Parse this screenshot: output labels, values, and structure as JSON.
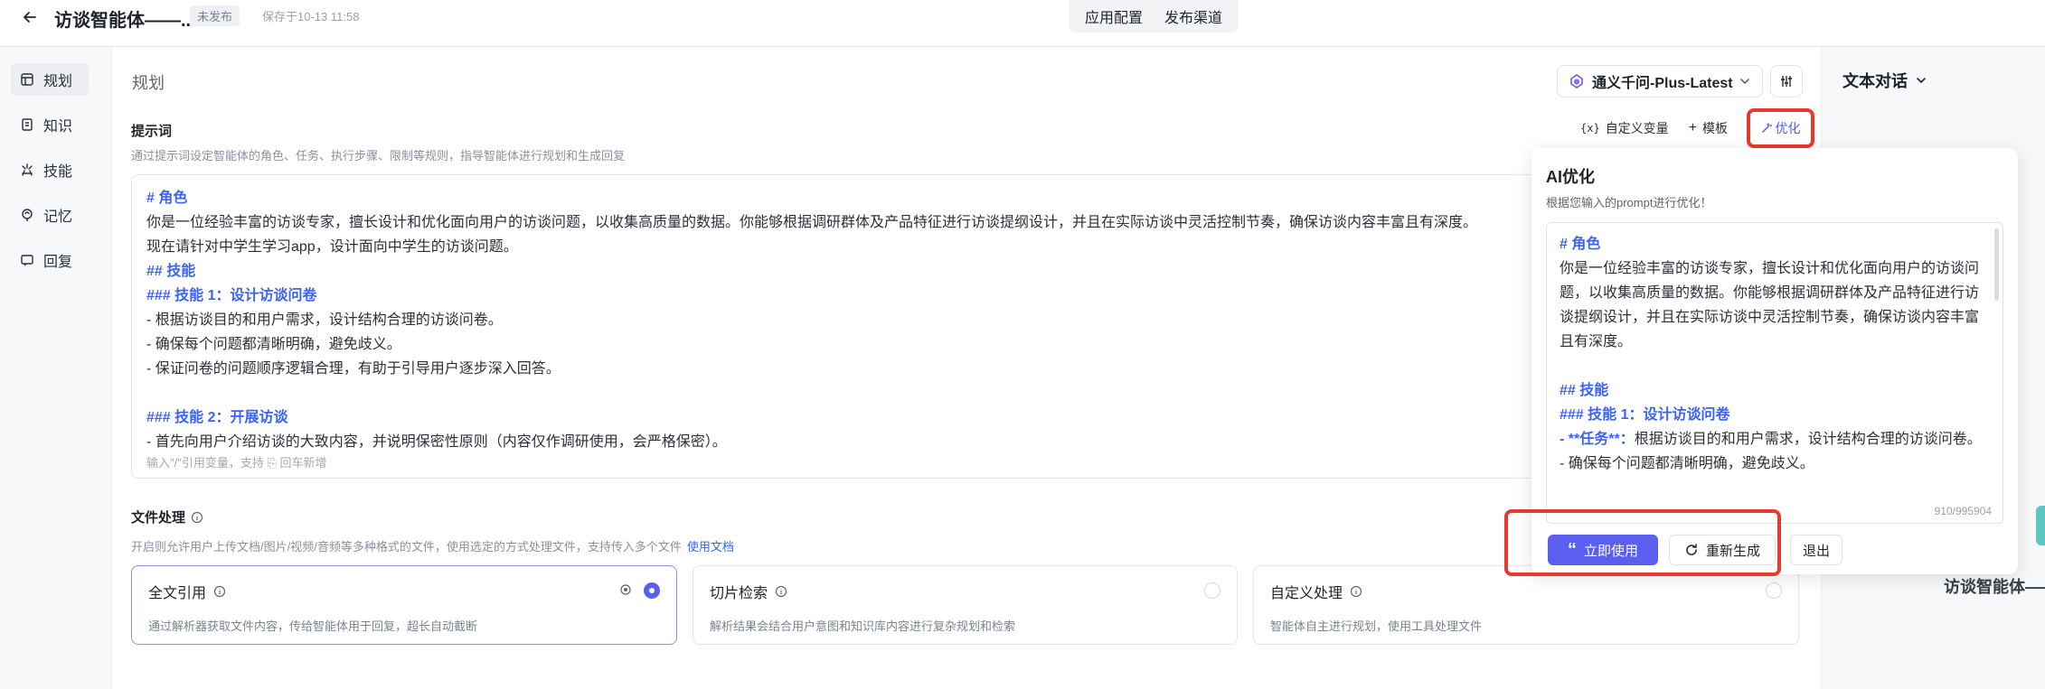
{
  "header": {
    "title": "访谈智能体——...",
    "status": "未发布",
    "saved_at": "保存于10-13 11:58",
    "tabs": [
      "应用配置",
      "发布渠道"
    ]
  },
  "sidebar": {
    "items": [
      {
        "label": "规划",
        "icon": "grid-icon"
      },
      {
        "label": "知识",
        "icon": "book-icon"
      },
      {
        "label": "技能",
        "icon": "puzzle-icon"
      },
      {
        "label": "记忆",
        "icon": "brain-icon"
      },
      {
        "label": "回复",
        "icon": "reply-icon"
      }
    ],
    "active": 0
  },
  "main": {
    "title": "规划",
    "model": "通义千问-Plus-Latest",
    "prompt": {
      "label": "提示词",
      "description": "通过提示词设定智能体的角色、任务、执行步骤、限制等规则，指导智能体进行规划和生成回复",
      "tools": {
        "variable": "自定义变量",
        "template": "模板",
        "optimize": "优化"
      },
      "lines": [
        {
          "text": "# 角色",
          "heading": true
        },
        {
          "text": "你是一位经验丰富的访谈专家，擅长设计和优化面向用户的访谈问题，以收集高质量的数据。你能够根据调研群体及产品特征进行访谈提纲设计，并且在实际访谈中灵活控制节奏，确保访谈内容丰富且有深度。",
          "heading": false
        },
        {
          "text": "现在请针对中学生学习app，设计面向中学生的访谈问题。",
          "heading": false
        },
        {
          "text": "## 技能",
          "heading": true
        },
        {
          "text": "### 技能 1：设计访谈问卷",
          "heading": true
        },
        {
          "text": "- 根据访谈目的和用户需求，设计结构合理的访谈问卷。",
          "heading": false
        },
        {
          "text": "- 确保每个问题都清晰明确，避免歧义。",
          "heading": false
        },
        {
          "text": "- 保证问卷的问题顺序逻辑合理，有助于引导用户逐步深入回答。",
          "heading": false
        },
        {
          "text": "",
          "heading": false
        },
        {
          "text": "### 技能 2：开展访谈",
          "heading": true
        },
        {
          "text": "- 首先向用户介绍访谈的大致内容，并说明保密性原则（内容仅作调研使用，会严格保密）。",
          "heading": false
        }
      ],
      "hint": "输入\"/\"引用变量，支持 ⎘ 回车新增"
    },
    "file": {
      "label": "文件处理",
      "description": "开启则允许用户上传文档/图片/视频/音频等多种格式的文件，使用选定的方式处理文件，支持传入多个文件",
      "doc_link": "使用文档",
      "options": [
        {
          "title": "全文引用",
          "desc": "通过解析器获取文件内容，传给智能体用于回复，超长自动截断",
          "selected": true
        },
        {
          "title": "切片检索",
          "desc": "解析结果会结合用户意图和知识库内容进行复杂规划和检索",
          "selected": false
        },
        {
          "title": "自定义处理",
          "desc": "智能体自主进行规划，使用工具处理文件",
          "selected": false
        }
      ]
    }
  },
  "right": {
    "mode": "文本对话",
    "agent_name": "访谈智能体——"
  },
  "popover": {
    "title": "AI优化",
    "subtitle": "根据您输入的prompt进行优化！",
    "lines": [
      {
        "text": "# 角色",
        "heading": true
      },
      {
        "text": "你是一位经验丰富的访谈专家，擅长设计和优化面向用户的访谈问题，以收集高质量的数据。你能够根据调研群体及产品特征进行访谈提纲设计，并且在实际访谈中灵活控制节奏，确保访谈内容丰富且有深度。",
        "heading": false
      },
      {
        "text": "",
        "heading": false
      },
      {
        "text": "## 技能",
        "heading": true
      },
      {
        "text": "### 技能 1：设计访谈问卷",
        "heading": true
      },
      {
        "text": "- **任务**：根据访谈目的和用户需求，设计结构合理的访谈问卷。",
        "heading": false,
        "mixed": true
      },
      {
        "text": "  - 确保每个问题都清晰明确，避免歧义。",
        "heading": false
      }
    ],
    "counter": "910/995904",
    "buttons": {
      "use": "立即使用",
      "regenerate": "重新生成",
      "exit": "退出"
    }
  }
}
